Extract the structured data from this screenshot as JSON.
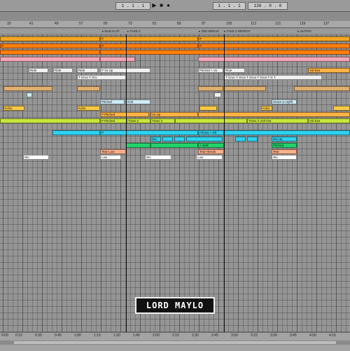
{
  "transport": {
    "arrangement_position": "1 . 1 . 1",
    "loop_start": "1 . 1 . 1",
    "loop_length": "136 . 0 . 0",
    "play_icon": "play-icon",
    "stop_icon": "stop-icon",
    "record_icon": "record-icon"
  },
  "ruler": [
    "33",
    "41",
    "49",
    "57",
    "65",
    "73",
    "81",
    "89",
    "97",
    "105",
    "113",
    "121",
    "129",
    "137"
  ],
  "locators": [
    {
      "label": "▸ BUILD-UP"
    },
    {
      "label": "▸ TAKE 2"
    },
    {
      "label": "▸ 2ND BREAK"
    },
    {
      "label": "▸ TAKE 2 REPEAT"
    },
    {
      "label": "▸ OUTRO"
    }
  ],
  "clips": [
    {
      "label": "P",
      "color": "#f5a623"
    },
    {
      "label": "P",
      "color": "#f5a623"
    },
    {
      "label": "",
      "color": "#f5a623"
    },
    {
      "label": "P",
      "color": "#ff7f0e"
    },
    {
      "label": "P",
      "color": "#ff7f0e"
    },
    {
      "label": "P",
      "color": "#ff7f0e"
    },
    {
      "label": "Ride",
      "color": "#f0f0f0"
    },
    {
      "label": "Ride",
      "color": "#f0f0f0"
    },
    {
      "label": "Ride",
      "color": "#f0f0f0"
    },
    {
      "label": "P Vo Up",
      "color": "#f0f0f0"
    },
    {
      "label": "Pitched + Vo",
      "color": "#f0f0f0"
    },
    {
      "label": "Ride",
      "color": "#f0f0f0"
    },
    {
      "label": "T Groo T Gro",
      "color": "#f0f0f0"
    },
    {
      "label": "T Groo T Groo T Groo T Groo T G T",
      "color": "#f0f0f0"
    },
    {
      "label": "Pitched",
      "color": "#cfeaf5"
    },
    {
      "label": "Roll",
      "color": "#cfeaf5"
    },
    {
      "label": "Snare w Uplift",
      "color": "#cfeaf5"
    },
    {
      "label": "Kobo",
      "color": "#f7c948"
    },
    {
      "label": "Kobo",
      "color": "#f7c948"
    },
    {
      "label": "Kobo",
      "color": "#f7c948"
    },
    {
      "label": "P Pitched",
      "color": "#ffb347"
    },
    {
      "label": "Vo Up",
      "color": "#ffb347"
    },
    {
      "label": "Vol Exe",
      "color": "#ffb347"
    },
    {
      "label": "P Pitched",
      "color": "#c8e63c"
    },
    {
      "label": "Trans 2",
      "color": "#c8e63c"
    },
    {
      "label": "Trans 3",
      "color": "#c8e63c"
    },
    {
      "label": "Trans 2 Volt Out",
      "color": "#c8e63c"
    },
    {
      "label": "Vol Exe",
      "color": "#c8e63c"
    },
    {
      "label": "P",
      "color": "#2ed2f0"
    },
    {
      "label": "Fill Dw + Fill",
      "color": "#2ed2f0"
    },
    {
      "label": "Dw",
      "color": "#2ed2f0"
    },
    {
      "label": "Dw Up",
      "color": "#2ed2f0"
    },
    {
      "label": "+ JLW",
      "color": "#22d36a"
    },
    {
      "label": "Pitched",
      "color": "#22d36a"
    },
    {
      "label": "Tear-Low",
      "color": "#ffb08a"
    },
    {
      "label": "Tear+Break",
      "color": "#ffb08a"
    },
    {
      "label": "Tear",
      "color": "#ffb08a"
    },
    {
      "label": "Wo",
      "color": "#ffffff"
    },
    {
      "label": "Low",
      "color": "#ffffff"
    },
    {
      "label": "Wo",
      "color": "#ffffff"
    },
    {
      "label": "Low",
      "color": "#ffffff"
    },
    {
      "label": "Wo",
      "color": "#ffffff"
    }
  ],
  "logo": {
    "text": "LORD MAYLO"
  },
  "timeline": [
    "0:00",
    "0:15",
    "0:30",
    "0:45",
    "1:00",
    "1:15",
    "1:30",
    "1:45",
    "2:00",
    "2:15",
    "2:30",
    "2:45",
    "3:00",
    "3:15",
    "3:30",
    "3:45",
    "4:00",
    "4:15"
  ]
}
